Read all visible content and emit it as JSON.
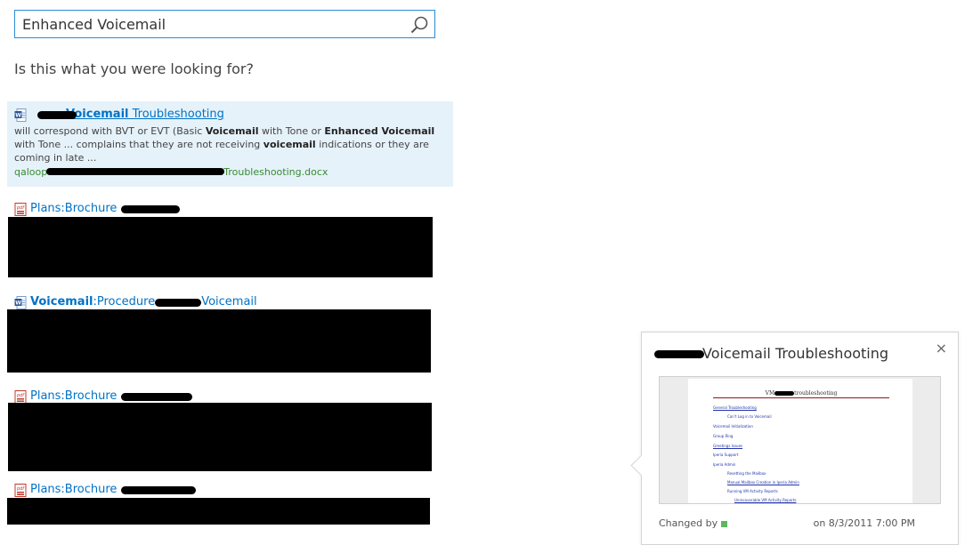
{
  "search": {
    "query": "Enhanced Voicemail"
  },
  "suggestion_text": "Is this what you were looking for?",
  "results": [
    {
      "file_type": "word",
      "title_bold": "Voicemail",
      "title_rest": " Troubleshooting",
      "snippet": {
        "p1": "will correspond with BVT or EVT (Basic ",
        "b1": "Voicemail",
        "p2": " with Tone or ",
        "b2": "Enhanced Voicemail",
        "p3": " with Tone ... complains that they are not receiving ",
        "b3": "voicemail",
        "p4": " indications or they are coming in late ..."
      },
      "url_start": "qaloop",
      "url_end": "Troubleshooting.docx"
    },
    {
      "file_type": "pdf",
      "title_rest": "Plans:Brochure"
    },
    {
      "file_type": "word",
      "title_bold": "Voicemail",
      "title_mid": ":Procedure",
      "title_end": "Voicemail"
    },
    {
      "file_type": "pdf",
      "title_rest": "Plans:Brochure"
    },
    {
      "file_type": "pdf",
      "title_rest": "Plans:Brochure"
    }
  ],
  "callout": {
    "title": "Voicemail Troubleshooting",
    "close_glyph": "×",
    "preview": {
      "heading_start": "VM",
      "heading_end": "troubleshooting",
      "lines": [
        "General Troubleshooting",
        "Can't Log in to Voicemail",
        "Voicemail Initialization",
        "Group Ring",
        "Greetings Issues",
        "Iperia Support",
        "Iperia Admin",
        "Resetting the Mailbox",
        "Manual Mailbox Creation in Iperia Admin",
        "Running VM Activity Reports",
        "Unrecoverable VM Activity Reports"
      ]
    },
    "changed_by_label": "Changed by",
    "changed_date": "on 8/3/2011 7:00 PM"
  },
  "colors": {
    "accent_border": "#2a8dd4",
    "link": "#0072c6",
    "url_green": "#388a34",
    "highlight_bg": "#e6f2fa"
  }
}
